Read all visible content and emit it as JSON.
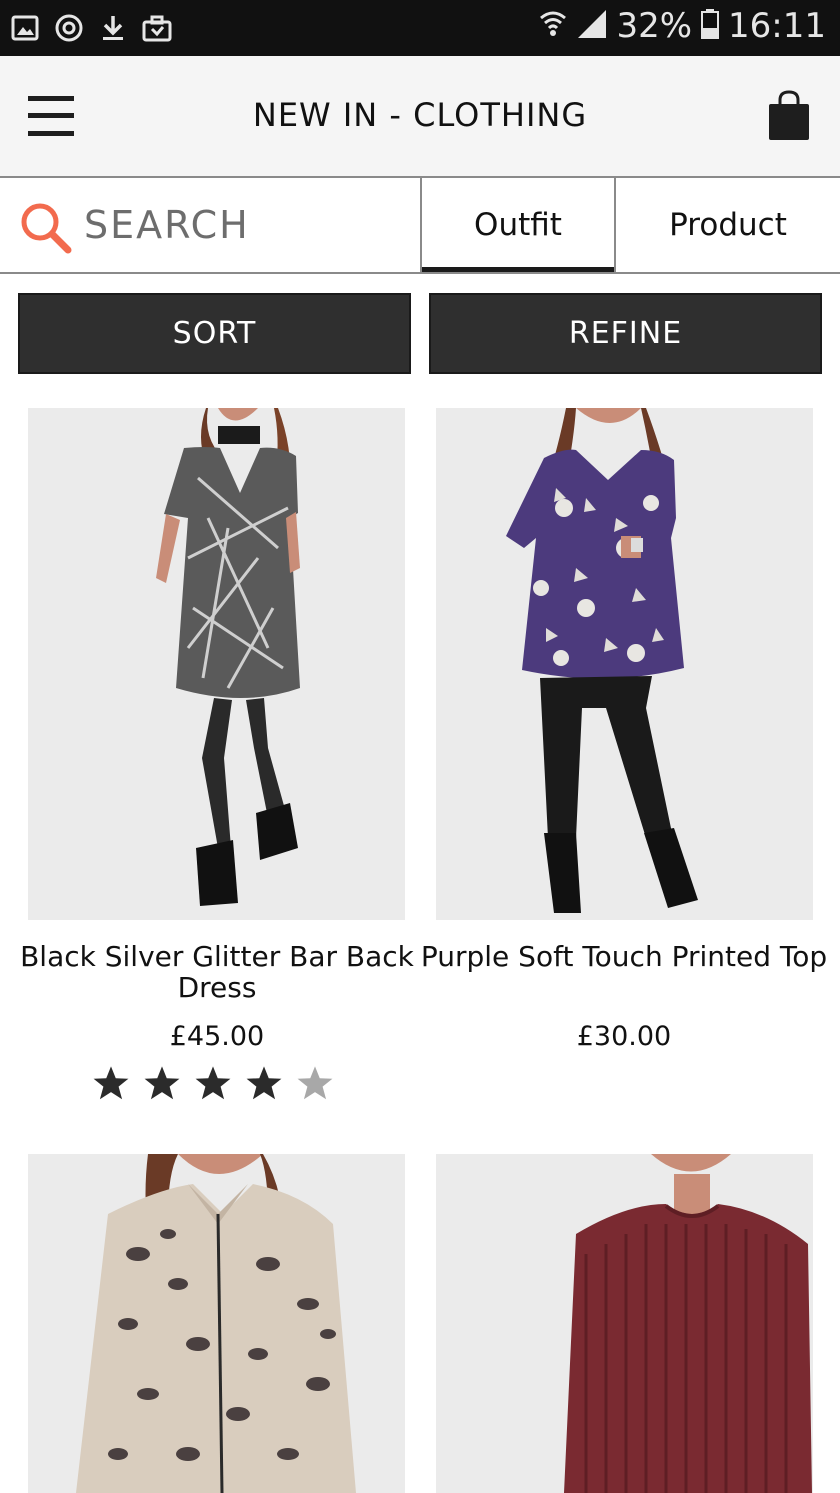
{
  "status_bar": {
    "icons": [
      "gallery-icon",
      "sync-icon",
      "download-icon",
      "briefcase-icon",
      "wifi-icon",
      "signal-icon",
      "battery-icon"
    ],
    "battery_percent": "32%",
    "time": "16:11"
  },
  "header": {
    "title": "NEW IN - CLOTHING",
    "menu_icon": "hamburger-menu-icon",
    "bag_icon": "shopping-bag-icon"
  },
  "search": {
    "placeholder": "SEARCH",
    "icon": "search-icon",
    "icon_color": "#f26b4e"
  },
  "view_tabs": {
    "outfit_label": "Outfit",
    "product_label": "Product",
    "active": "Outfit"
  },
  "actions": {
    "sort_label": "SORT",
    "refine_label": "REFINE"
  },
  "products": [
    {
      "name": "Black Silver Glitter Bar Back Dress",
      "price": "£45.00",
      "rating": 4,
      "rating_max": 5
    },
    {
      "name": "Purple Soft Touch Printed Top",
      "price": "£30.00"
    },
    {
      "name": "",
      "price": ""
    },
    {
      "name": "",
      "price": ""
    }
  ],
  "colors": {
    "button_bg": "#2f2f2f",
    "accent_search": "#f26b4e",
    "star_filled": "#2b2b2b",
    "star_empty": "#a8a8a8"
  }
}
